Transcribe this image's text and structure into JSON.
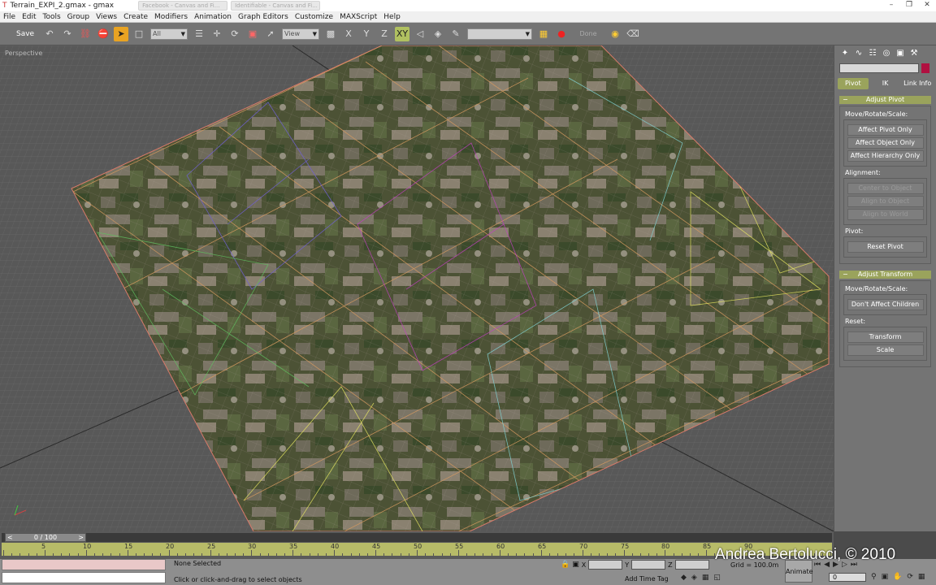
{
  "window": {
    "title": "Terrain_EXPI_2.gmax - gmax",
    "ghost_tabs": [
      "Facebook - Canvas and Fi...",
      "Identifiable - Canvas and Fi..."
    ],
    "controls": [
      "minimize",
      "restore",
      "close"
    ]
  },
  "menu": [
    "File",
    "Edit",
    "Tools",
    "Group",
    "Views",
    "Create",
    "Modifiers",
    "Animation",
    "Graph Editors",
    "Customize",
    "MAXScript",
    "Help"
  ],
  "toolbar": {
    "save_label": "Save",
    "filter_value": "All",
    "refcoord_value": "View",
    "named_sel_value": "",
    "done_label": "Done"
  },
  "viewport": {
    "label": "Perspective"
  },
  "command_panel": {
    "subtabs": [
      "Pivot",
      "IK",
      "Link Info"
    ],
    "selected_subtab": "Pivot",
    "adjust_pivot": {
      "title": "Adjust Pivot",
      "group1_label": "Move/Rotate/Scale:",
      "btn_affect_pivot": "Affect Pivot Only",
      "btn_affect_object": "Affect Object Only",
      "btn_affect_hierarchy": "Affect Hierarchy Only",
      "group2_label": "Alignment:",
      "btn_center": "Center to Object",
      "btn_align_object": "Align to Object",
      "btn_align_world": "Align to World",
      "group3_label": "Pivot:",
      "btn_reset_pivot": "Reset Pivot"
    },
    "adjust_transform": {
      "title": "Adjust Transform",
      "group1_label": "Move/Rotate/Scale:",
      "btn_dont_affect": "Don't Affect Children",
      "group2_label": "Reset:",
      "btn_transform": "Transform",
      "btn_scale": "Scale"
    }
  },
  "timeline": {
    "frame_label": "0 / 100",
    "ticks": [
      0,
      5,
      10,
      15,
      20,
      25,
      30,
      35,
      40,
      45,
      50,
      55,
      60,
      65,
      70,
      75,
      80,
      85,
      90
    ]
  },
  "status": {
    "selection": "None Selected",
    "prompt": "Click or click-and-drag to select objects",
    "x_label": "X",
    "y_label": "Y",
    "z_label": "Z",
    "grid": "Grid = 100.0m",
    "animate": "Animate",
    "add_time_tag": "Add Time Tag",
    "frame_value": "0"
  },
  "copyright": "Andrea Bertolucci, © 2010"
}
